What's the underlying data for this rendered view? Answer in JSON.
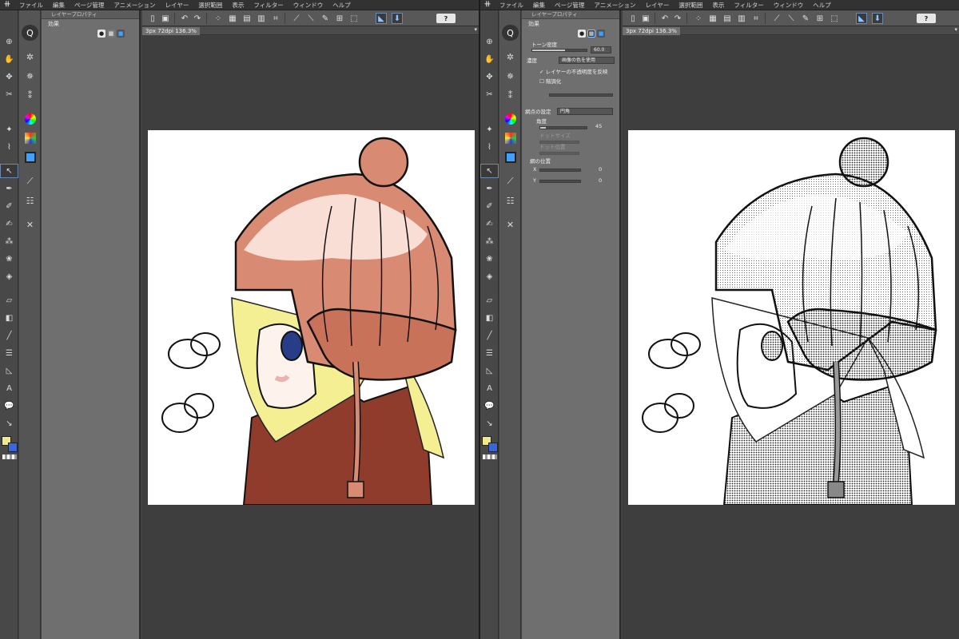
{
  "menu": [
    "ファイル",
    "編集",
    "ページ管理",
    "アニメーション",
    "レイヤー",
    "選択範囲",
    "表示",
    "フィルター",
    "ウィンドウ",
    "ヘルプ"
  ],
  "left_pane": {
    "palette_title": "レイヤープロパティ",
    "effect_label": "効果",
    "doc_tab": "3px 72dpi 136.3%"
  },
  "right_pane": {
    "palette_title": "レイヤープロパティ",
    "effect_label": "効果",
    "doc_tab": "3px 72dpi 136.3%",
    "tone_density_label": "トーン密度",
    "tone_density_value": "60.0",
    "density_label": "濃度",
    "density_select": "画像の色を使用",
    "use_layer_check": "レイヤーの不透明度を反映",
    "posterize_label": "階調化",
    "dot_settings_label": "網点の設定",
    "dot_type": "円角",
    "angle_label": "角度",
    "angle_value": "45",
    "dot_size_label": "ドットサイズ",
    "dot_position_label": "ドット位置",
    "position_label": "網の位置",
    "x_label": "X",
    "y_label": "Y",
    "x_value": "0",
    "y_value": "0"
  },
  "colors": {
    "hat": "#d98a72",
    "hat_shade": "#c9725a",
    "jacket": "#8f3c2c",
    "hair": "#f4ef92",
    "fg_color": "#f0e98a",
    "bg_color": "#3a66d6",
    "accent": "#6a88b0"
  }
}
